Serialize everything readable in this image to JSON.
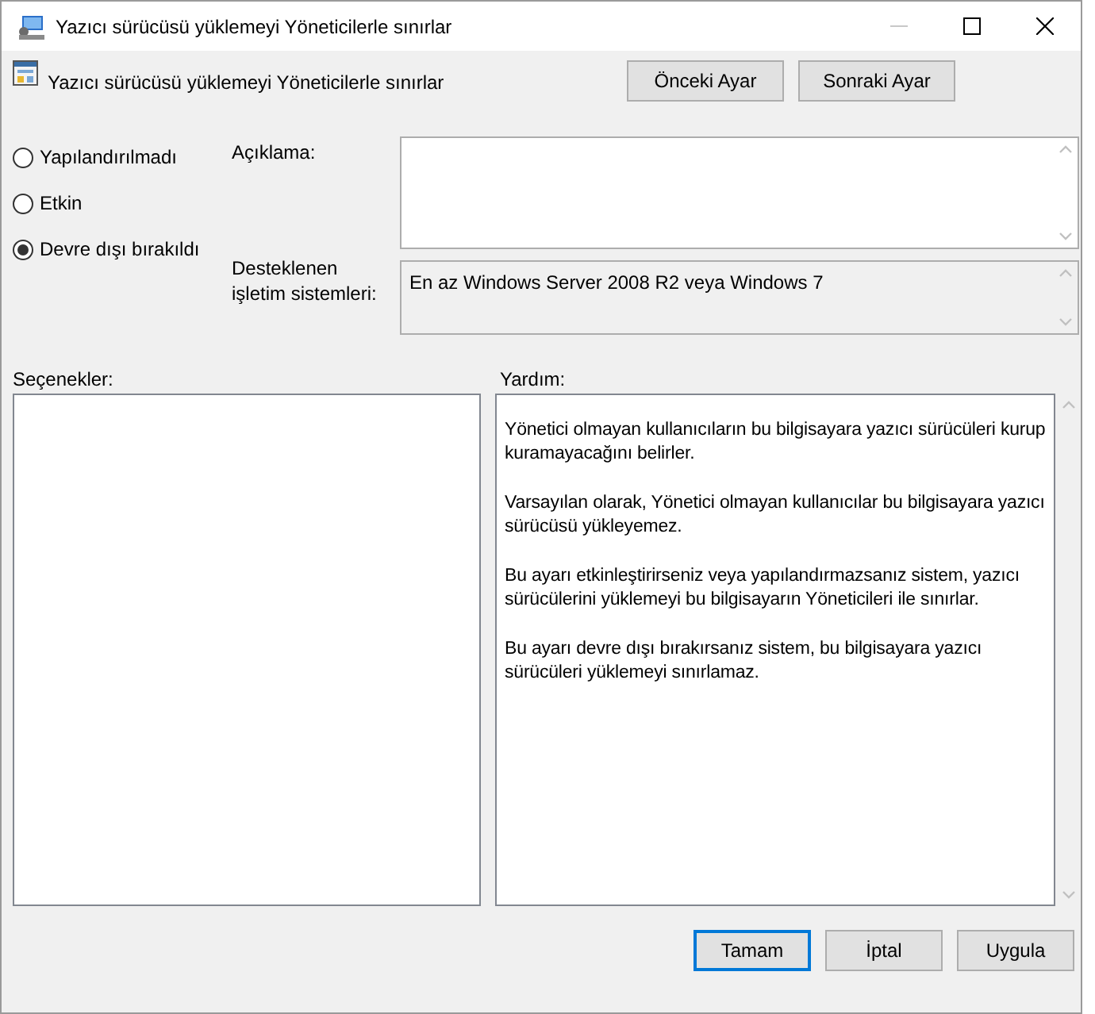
{
  "window": {
    "title": "Yazıcı sürücüsü yüklemeyi Yöneticilerle sınırlar"
  },
  "title_buttons": [
    {
      "kind": "minimize",
      "disabled": true
    },
    {
      "kind": "maximize",
      "disabled": false
    },
    {
      "kind": "close",
      "disabled": false
    }
  ],
  "header": {
    "title": "Yazıcı sürücüsü yüklemeyi Yöneticilerle sınırlar",
    "buttons": [
      "Önceki Ayar",
      "Sonraki Ayar"
    ]
  },
  "states": [
    {
      "label": "Yapılandırılmadı",
      "selected": false
    },
    {
      "label": "Etkin",
      "selected": false
    },
    {
      "label": "Devre dışı bırakıldı",
      "selected": true
    }
  ],
  "description": {
    "label": "Açıklama:"
  },
  "supported": {
    "label": "Desteklenen işletim sistemleri:",
    "value": "En az Windows Server 2008 R2 veya Windows 7"
  },
  "options": {
    "label": "Seçenekler:"
  },
  "help": {
    "label": "Yardım:",
    "paragraphs": [
      "Yönetici olmayan kullanıcıların bu bilgisayara yazıcı sürücüleri kurup kuramayacağını belirler.",
      "Varsayılan olarak, Yönetici olmayan kullanıcılar bu bilgisayara yazıcı sürücüsü yükleyemez.",
      "Bu ayarı etkinleştirirseniz veya yapılandırmazsanız sistem, yazıcı sürücülerini yüklemeyi bu bilgisayarın Yöneticileri ile sınırlar.",
      "Bu ayarı devre dışı bırakırsanız sistem, bu bilgisayara yazıcı sürücüleri yüklemeyi sınırlamaz."
    ]
  },
  "buttons": [
    {
      "label": "Tamam",
      "default": true
    },
    {
      "label": "İptal",
      "default": false
    },
    {
      "label": "Uygula",
      "default": false
    }
  ]
}
